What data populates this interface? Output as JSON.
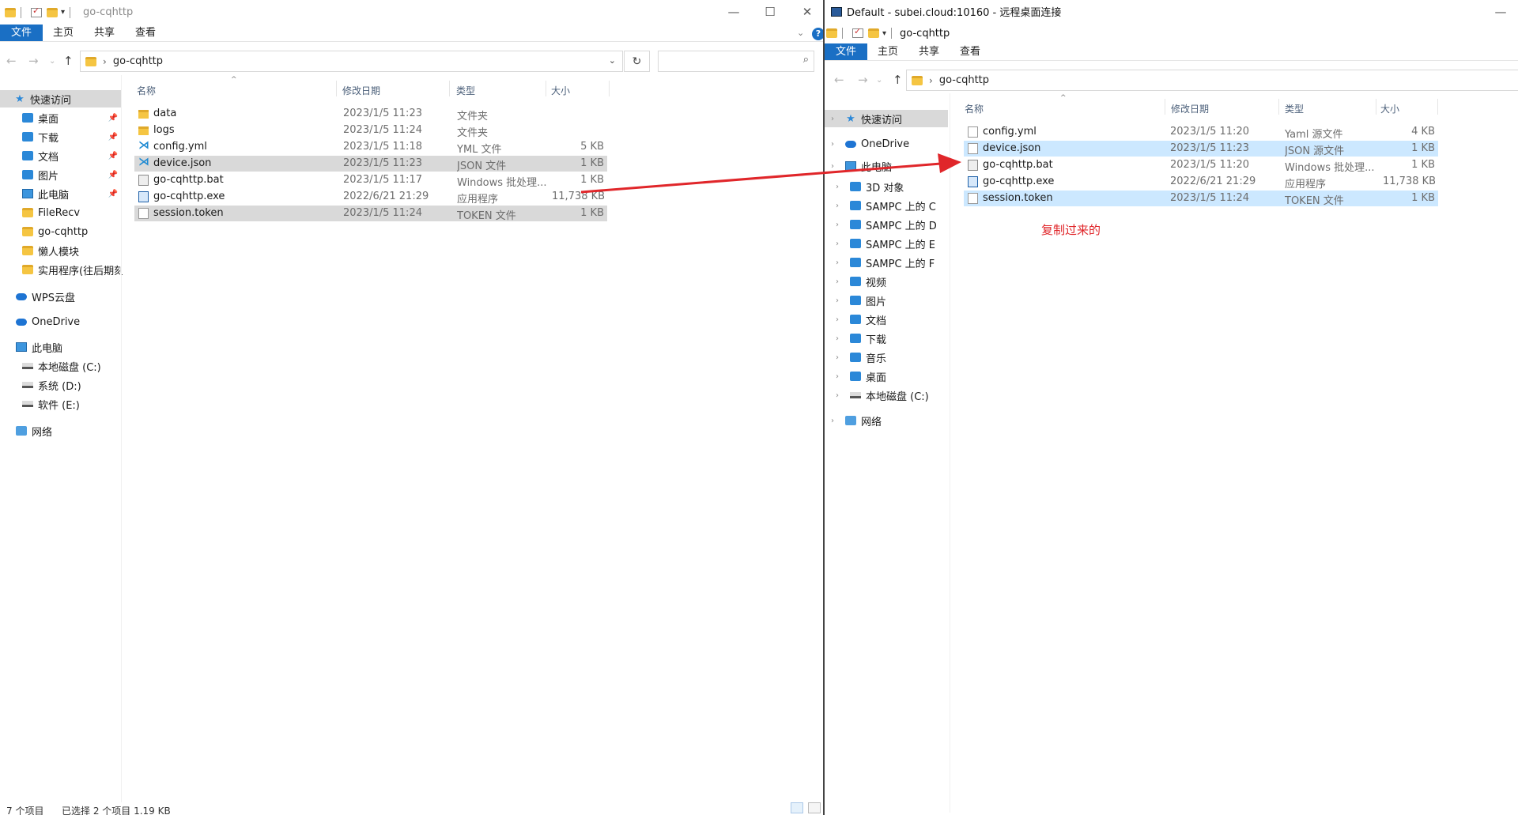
{
  "left": {
    "title": "go-cqhttp",
    "ribbon_tabs": [
      "文件",
      "主页",
      "共享",
      "查看"
    ],
    "address_folder": "go-cqhttp",
    "search_placeholder": "",
    "nav_items": [
      {
        "label": "快速访问",
        "icon": "star-icon"
      },
      {
        "label": "桌面",
        "icon": "desktop-icon",
        "pinned": true
      },
      {
        "label": "下载",
        "icon": "download-icon",
        "pinned": true
      },
      {
        "label": "文档",
        "icon": "document-icon",
        "pinned": true
      },
      {
        "label": "图片",
        "icon": "picture-icon",
        "pinned": true
      },
      {
        "label": "此电脑",
        "icon": "pc-icon",
        "pinned": true
      },
      {
        "label": "FileRecv",
        "icon": "folder-icon"
      },
      {
        "label": "go-cqhttp",
        "icon": "folder-icon"
      },
      {
        "label": "懒人模块",
        "icon": "folder-icon"
      },
      {
        "label": "实用程序(往后期刻录)",
        "icon": "folder-icon"
      },
      {
        "label": "WPS云盘",
        "icon": "cloud-icon"
      },
      {
        "label": "OneDrive",
        "icon": "cloud-icon"
      },
      {
        "label": "此电脑",
        "icon": "pc-icon"
      },
      {
        "label": "本地磁盘 (C:)",
        "icon": "disk-icon"
      },
      {
        "label": "系统 (D:)",
        "icon": "disk-icon"
      },
      {
        "label": "软件 (E:)",
        "icon": "disk-icon"
      },
      {
        "label": "网络",
        "icon": "network-icon"
      }
    ],
    "columns": {
      "name": "名称",
      "date": "修改日期",
      "type": "类型",
      "size": "大小"
    },
    "files": [
      {
        "name": "data",
        "date": "2023/1/5 11:23",
        "type": "文件夹",
        "size": "",
        "icon": "folder-icon"
      },
      {
        "name": "logs",
        "date": "2023/1/5 11:24",
        "type": "文件夹",
        "size": "",
        "icon": "folder-icon"
      },
      {
        "name": "config.yml",
        "date": "2023/1/5 11:18",
        "type": "YML 文件",
        "size": "5 KB",
        "icon": "vscode-icon"
      },
      {
        "name": "device.json",
        "date": "2023/1/5 11:23",
        "type": "JSON 文件",
        "size": "1 KB",
        "icon": "vscode-icon",
        "selected": true
      },
      {
        "name": "go-cqhttp.bat",
        "date": "2023/1/5 11:17",
        "type": "Windows 批处理...",
        "size": "1 KB",
        "icon": "bat-icon"
      },
      {
        "name": "go-cqhttp.exe",
        "date": "2022/6/21 21:29",
        "type": "应用程序",
        "size": "11,738 KB",
        "icon": "exe-icon"
      },
      {
        "name": "session.token",
        "date": "2023/1/5 11:24",
        "type": "TOKEN 文件",
        "size": "1 KB",
        "icon": "file-icon",
        "selected": true
      }
    ],
    "status_count": "7 个项目",
    "status_selected": "已选择 2 个项目  1.19 KB"
  },
  "right": {
    "title": "Default - subei.cloud:10160 - 远程桌面连接",
    "inner_title": "go-cqhttp",
    "ribbon_tabs": [
      "文件",
      "主页",
      "共享",
      "查看"
    ],
    "address_folder": "go-cqhttp",
    "nav_items": [
      {
        "label": "快速访问",
        "icon": "star-icon"
      },
      {
        "label": "OneDrive",
        "icon": "cloud-icon"
      },
      {
        "label": "此电脑",
        "icon": "pc-icon"
      },
      {
        "label": "3D 对象",
        "icon": "cube-icon"
      },
      {
        "label": "SAMPC 上的 C",
        "icon": "net-drive-icon"
      },
      {
        "label": "SAMPC 上的 D",
        "icon": "net-drive-icon"
      },
      {
        "label": "SAMPC 上的 E",
        "icon": "net-drive-icon"
      },
      {
        "label": "SAMPC 上的 F",
        "icon": "net-drive-icon"
      },
      {
        "label": "视频",
        "icon": "video-icon"
      },
      {
        "label": "图片",
        "icon": "picture-icon"
      },
      {
        "label": "文档",
        "icon": "document-icon"
      },
      {
        "label": "下载",
        "icon": "download-icon"
      },
      {
        "label": "音乐",
        "icon": "music-icon"
      },
      {
        "label": "桌面",
        "icon": "desktop-icon"
      },
      {
        "label": "本地磁盘 (C:)",
        "icon": "disk-icon"
      },
      {
        "label": "网络",
        "icon": "network-icon"
      }
    ],
    "columns": {
      "name": "名称",
      "date": "修改日期",
      "type": "类型",
      "size": "大小"
    },
    "files": [
      {
        "name": "config.yml",
        "date": "2023/1/5 11:20",
        "type": "Yaml 源文件",
        "size": "4 KB",
        "icon": "file-icon"
      },
      {
        "name": "device.json",
        "date": "2023/1/5 11:23",
        "type": "JSON 源文件",
        "size": "1 KB",
        "icon": "file-icon",
        "selected": true
      },
      {
        "name": "go-cqhttp.bat",
        "date": "2023/1/5 11:20",
        "type": "Windows 批处理...",
        "size": "1 KB",
        "icon": "bat-icon"
      },
      {
        "name": "go-cqhttp.exe",
        "date": "2022/6/21 21:29",
        "type": "应用程序",
        "size": "11,738 KB",
        "icon": "exe-icon"
      },
      {
        "name": "session.token",
        "date": "2023/1/5 11:24",
        "type": "TOKEN 文件",
        "size": "1 KB",
        "icon": "file-icon",
        "selected": true
      }
    ],
    "note": "复制过来的"
  },
  "colors": {
    "accent": "#1a6fc4",
    "annotation": "#e0262a",
    "selection_gray": "#d9d9d9",
    "selection_blue": "#cce8ff"
  }
}
